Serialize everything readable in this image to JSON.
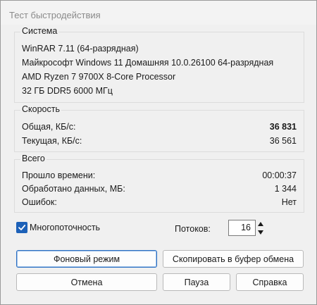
{
  "window": {
    "title": "Тест быстродействия"
  },
  "system": {
    "title": "Система",
    "lines": [
      "WinRAR 7.11 (64-разрядная)",
      "Майкрософт Windows 11 Домашняя 10.0.26100 64-разрядная",
      "AMD Ryzen 7 9700X 8-Core Processor",
      "32 ГБ DDR5 6000 МГц"
    ]
  },
  "speed": {
    "title": "Скорость",
    "rows": [
      {
        "label": "Общая, КБ/с:",
        "value": "36 831"
      },
      {
        "label": "Текущая, КБ/с:",
        "value": "36 561"
      }
    ]
  },
  "total": {
    "title": "Всего",
    "rows": [
      {
        "label": "Прошло времени:",
        "value": "00:00:37"
      },
      {
        "label": "Обработано данных, МБ:",
        "value": "1 344"
      },
      {
        "label": "Ошибок:",
        "value": "Нет"
      }
    ]
  },
  "options": {
    "multithread_label": "Многопоточность",
    "multithread_checked": true,
    "threads_label": "Потоков:",
    "threads_value": "16"
  },
  "buttons": {
    "background": "Фоновый режим",
    "copy": "Скопировать в буфер обмена",
    "cancel": "Отмена",
    "pause": "Пауза",
    "help": "Справка"
  },
  "colors": {
    "accent": "#1d61b8",
    "default_button_border": "#2c6fc2"
  }
}
